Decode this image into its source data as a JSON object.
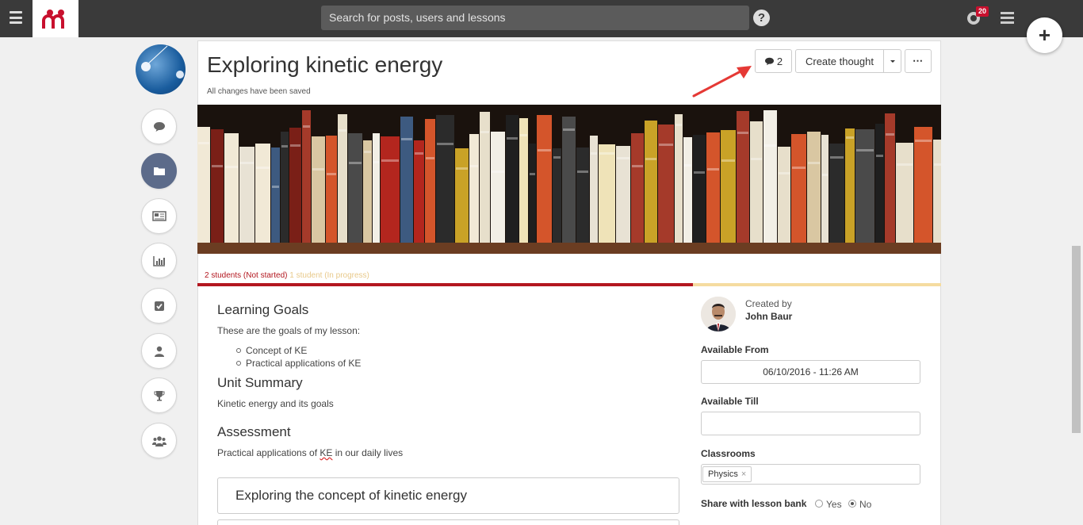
{
  "topbar": {
    "search_placeholder": "Search for posts, users and lessons",
    "help_label": "?",
    "notification_count": "20"
  },
  "fab": {
    "label": "+"
  },
  "lesson": {
    "title": "Exploring kinetic energy",
    "save_status": "All changes have been saved",
    "comment_count": "2",
    "create_thought_label": "Create thought",
    "more_label": "⋯"
  },
  "progress": {
    "not_started": "2 students (Not started)",
    "in_progress": "1 student (In progress)",
    "not_started_fraction": 0.667,
    "in_progress_fraction": 0.333,
    "colors": {
      "not_started": "#b3171f",
      "in_progress": "#f5dca0"
    }
  },
  "content": {
    "goals_heading": "Learning Goals",
    "goals_intro": "These are the goals of my lesson:",
    "goals": [
      "Concept of KE",
      "Practical applications of KE"
    ],
    "summary_heading": "Unit Summary",
    "summary_text": "Kinetic energy and its goals",
    "assessment_heading": "Assessment",
    "assessment_text_before": "Practical applications of ",
    "assessment_text_ke": "KE",
    "assessment_text_after": " in our daily lives",
    "section_title": "Exploring the concept of kinetic energy"
  },
  "sidebar": {
    "created_by_label": "Created by",
    "creator_name": "John Baur",
    "available_from_label": "Available From",
    "available_from_value": "06/10/2016 - 11:26 AM",
    "available_till_label": "Available Till",
    "available_till_value": "",
    "classrooms_label": "Classrooms",
    "classroom_tag": "Physics",
    "share_label": "Share with lesson bank",
    "share_yes": "Yes",
    "share_no": "No",
    "share_selected": "No"
  },
  "rail": {
    "items": [
      "chat-icon",
      "folder-icon",
      "newspaper-icon",
      "bar-chart-icon",
      "checkbox-icon",
      "user-icon",
      "trophy-icon",
      "group-icon"
    ],
    "active": "folder-icon"
  },
  "colors": {
    "brand": "#c8102e",
    "topbar": "#3a3a3a",
    "rail_active": "#5c6b8a"
  }
}
